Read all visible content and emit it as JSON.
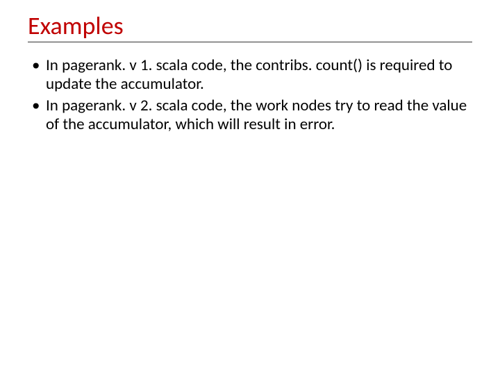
{
  "slide": {
    "title": "Examples",
    "bullets": [
      "In pagerank. v 1. scala code, the contribs. count() is required to update the accumulator.",
      "In pagerank. v 2. scala code, the work nodes try to read the value of the accumulator, which will result in error."
    ]
  }
}
